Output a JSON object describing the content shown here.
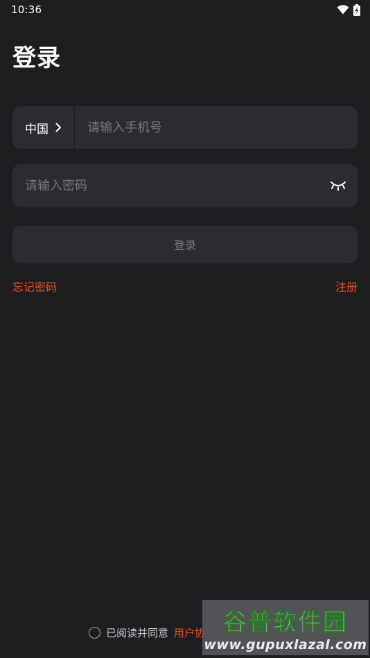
{
  "status_bar": {
    "time": "10:36",
    "icons": [
      "wifi-icon",
      "battery-charging-icon"
    ]
  },
  "title": "登录",
  "phone": {
    "country": "中国",
    "placeholder": "请输入手机号",
    "value": ""
  },
  "password": {
    "placeholder": "请输入密码",
    "value": "",
    "toggle_icon": "eye-closed-icon"
  },
  "login_button": "登录",
  "links": {
    "forgot_password": "忘记密码",
    "register": "注册"
  },
  "agreement": {
    "prefix": "已阅读并同意",
    "link": "用户协"
  },
  "watermark": {
    "cn": "谷普软件园",
    "url": "www.gupuxlazal.com"
  },
  "colors": {
    "background": "#1e1d20",
    "field": "#2c2b30",
    "accent": "#e8511f",
    "placeholder": "#77767b"
  }
}
